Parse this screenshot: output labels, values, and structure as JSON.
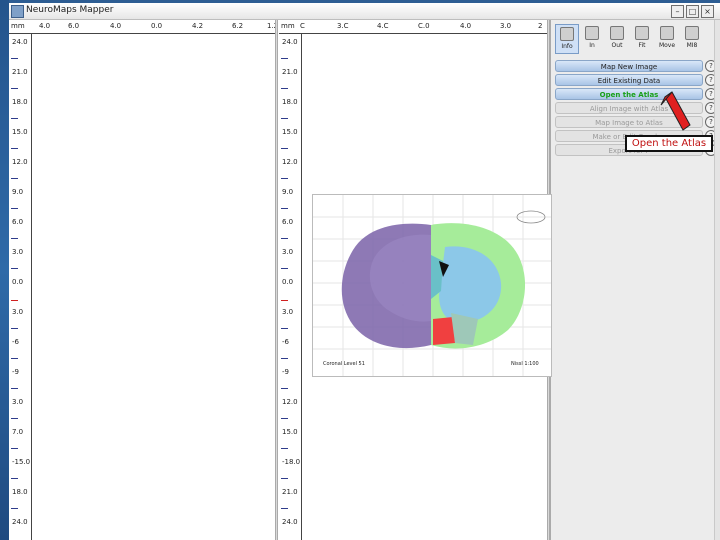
{
  "window": {
    "title": "NeuroMaps Mapper"
  },
  "panel1": {
    "unit": "mm",
    "x_ticks": [
      "4.0",
      "6.0",
      "4.0",
      "0.0",
      "4.2",
      "6.2",
      "1.2"
    ],
    "y_ticks": [
      "24.0",
      "21.0",
      "18.0",
      "15.0",
      "12.0",
      "9.0",
      "6.0",
      "3.0",
      "0.0",
      "3.0",
      "-6",
      "-9",
      "3.0",
      "7.0",
      "-15.0",
      "18.0",
      "24.0"
    ]
  },
  "panel2": {
    "unit": "mm",
    "x_ticks": [
      "C",
      "3.C",
      "4.C",
      "C.0",
      "4.0",
      "3.0",
      "2"
    ],
    "y_ticks": [
      "24.0",
      "21.0",
      "18.0",
      "15.0",
      "12.0",
      "9.0",
      "6.0",
      "3.0",
      "0.0",
      "3.0",
      "-6",
      "-9",
      "12.0",
      "15.0",
      "-18.0",
      "21.0",
      "24.0"
    ]
  },
  "toolbar": [
    {
      "label": "Info",
      "icon": "info-icon"
    },
    {
      "label": "In",
      "icon": "zoom-in-icon"
    },
    {
      "label": "Out",
      "icon": "zoom-out-icon"
    },
    {
      "label": "Fit",
      "icon": "fit-icon"
    },
    {
      "label": "Move",
      "icon": "move-icon"
    },
    {
      "label": "MI8",
      "icon": "image-icon"
    }
  ],
  "menu": [
    {
      "label": "Map New Image",
      "state": "enabled"
    },
    {
      "label": "Edit Existing Data",
      "state": "enabled"
    },
    {
      "label": "Open the Atlas",
      "state": "active"
    },
    {
      "label": "Align Image with Atlas",
      "state": "disabled"
    },
    {
      "label": "Map Image to Atlas",
      "state": "disabled"
    },
    {
      "label": "Make or Edit Overlay",
      "state": "disabled"
    },
    {
      "label": "Export for F",
      "state": "disabled"
    }
  ],
  "callout": {
    "text": "Open the Atlas"
  },
  "atlas": {
    "caption_left": "Coronal Level 51",
    "caption_right": "Nissl 1:100"
  },
  "colors": {
    "accent_green": "#18a018",
    "callout_text": "#c01010",
    "arrow": "#e02020"
  }
}
